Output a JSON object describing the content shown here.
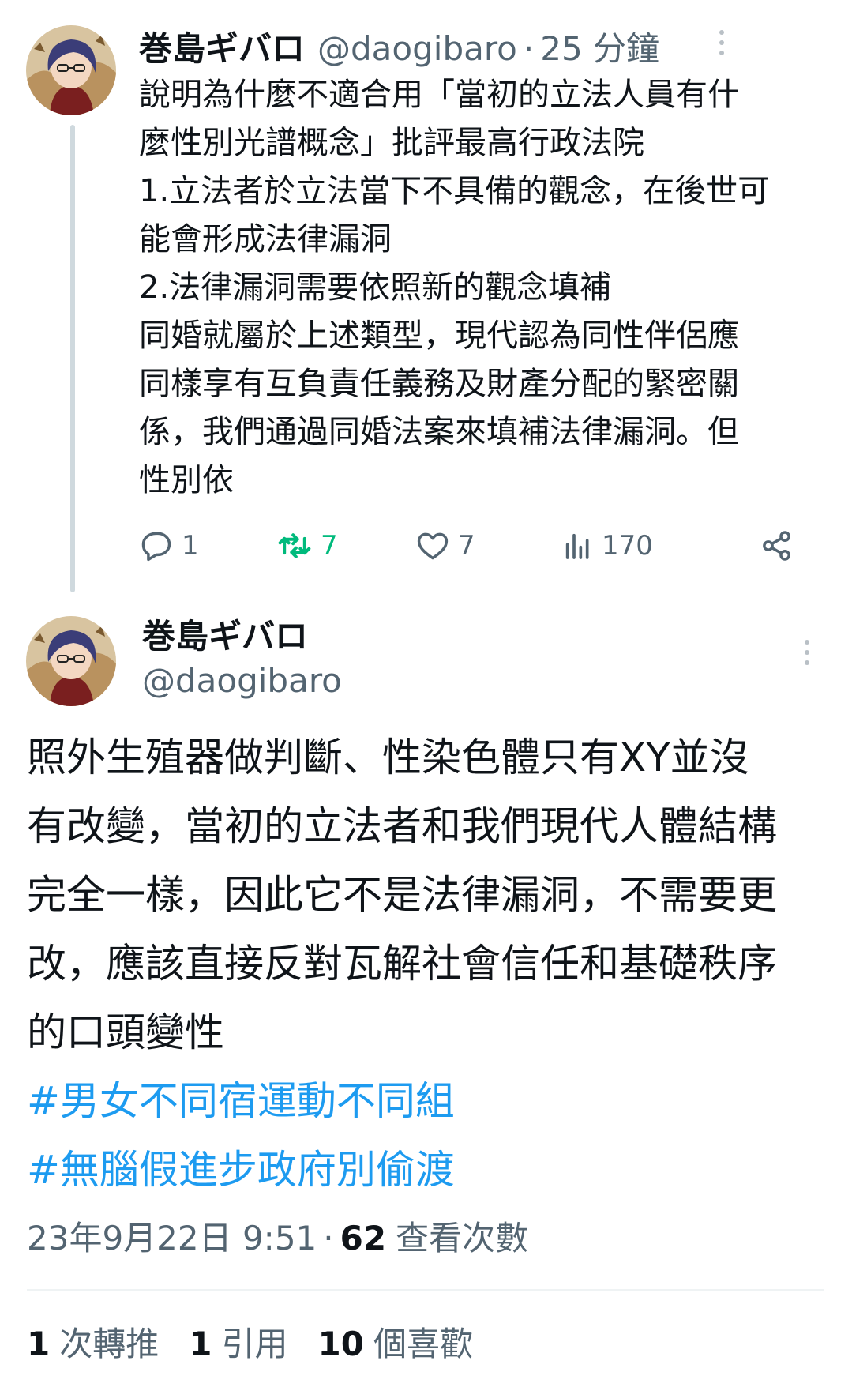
{
  "tweet1": {
    "name": "巻島ギバロ",
    "handle": "@daogibaro",
    "separator": "·",
    "time": "25 分鐘",
    "body_lines": [
      "說明為什麼不適合用「當初的立法人員有什",
      "麼性別光譜概念」批評最高行政法院",
      "1.立法者於立法當下不具備的觀念，在後世可",
      "能會形成法律漏洞",
      "2.法律漏洞需要依照新的觀念填補",
      "同婚就屬於上述類型，現代認為同性伴侶應",
      "同樣享有互負責任義務及財產分配的緊密關",
      "係，我們通過同婚法案來填補法律漏洞。但",
      "性別依"
    ],
    "actions": {
      "reply_count": "1",
      "retweet_count": "7",
      "like_count": "7",
      "view_count": "170"
    }
  },
  "tweet2": {
    "name": "巻島ギバロ",
    "handle": "@daogibaro",
    "body_lines": [
      "照外生殖器做判斷、性染色體只有XY並沒",
      "有改變，當初的立法者和我們現代人體結構",
      "完全一樣，因此它不是法律漏洞，不需要更",
      "改，應該直接反對瓦解社會信任和基礎秩序",
      "的口頭變性"
    ],
    "hashtags": [
      "#男女不同宿運動不同組",
      "#無腦假進步政府別偷渡"
    ],
    "meta": {
      "datetime": "23年9月22日 9:51",
      "separator": "·",
      "views_count": "62",
      "views_label": "查看次數"
    },
    "stats": {
      "retweets_count": "1",
      "retweets_label": "次轉推",
      "quotes_count": "1",
      "quotes_label": "引用",
      "likes_count": "10",
      "likes_label": "個喜歡"
    }
  },
  "colors": {
    "text": "#0f1419",
    "secondary": "#536471",
    "link": "#1d9bf0",
    "retweet": "#00ba7c",
    "thread_line": "#cfd9de"
  },
  "icons": [
    "avatar",
    "more-options-icon",
    "reply-icon",
    "retweet-icon",
    "like-icon",
    "views-icon",
    "share-icon"
  ]
}
